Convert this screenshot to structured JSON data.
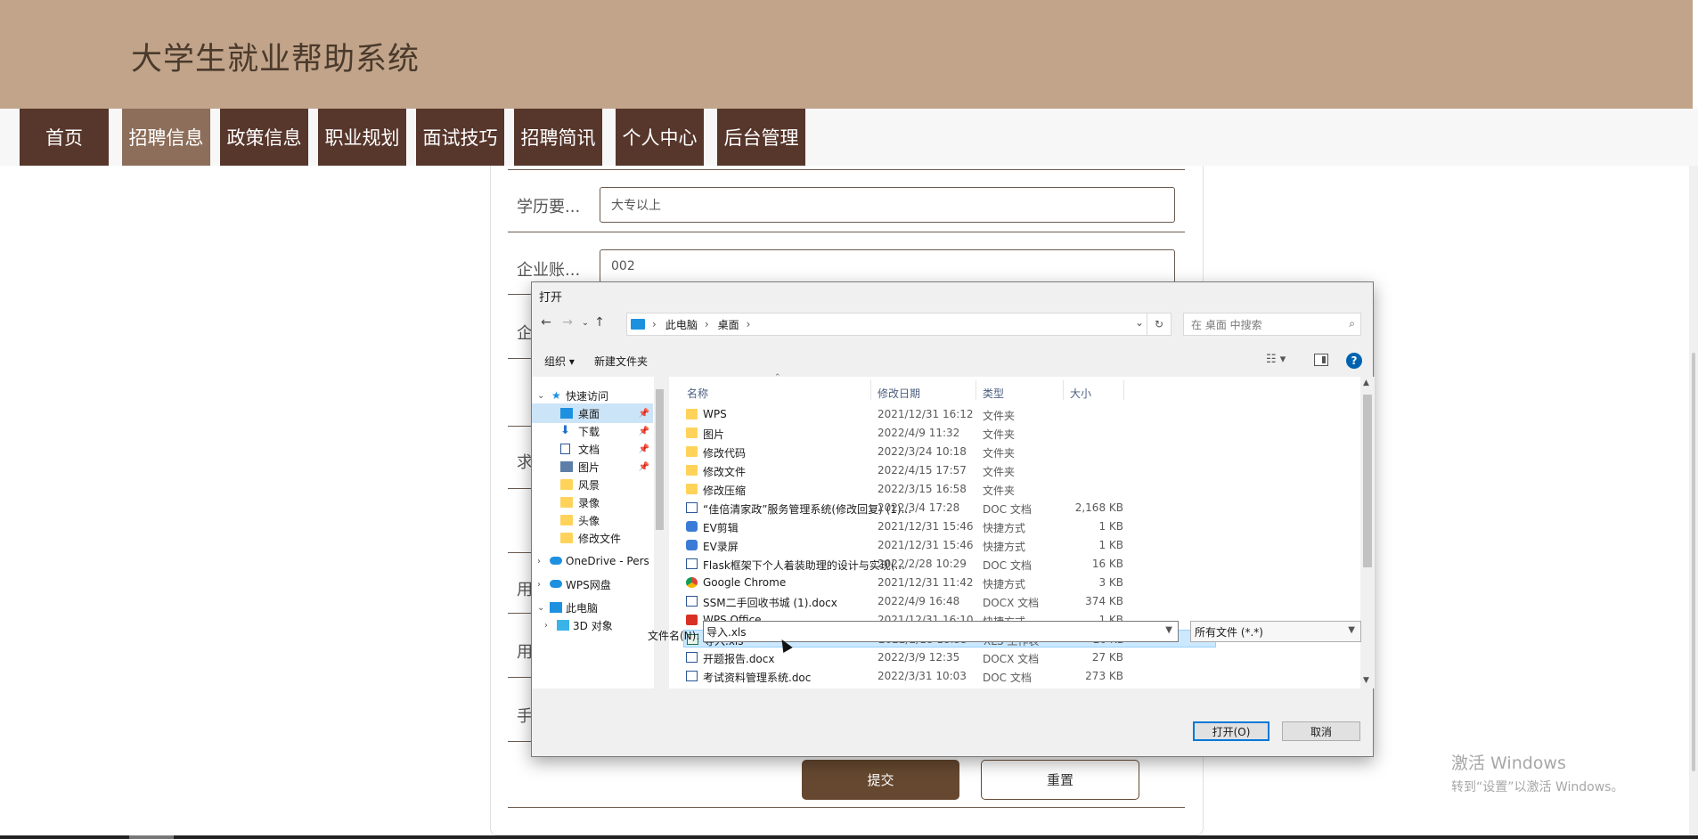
{
  "header": {
    "title": "大学生就业帮助系统"
  },
  "nav": {
    "items": [
      {
        "label": "首页"
      },
      {
        "label": "招聘信息"
      },
      {
        "label": "政策信息"
      },
      {
        "label": "职业规划"
      },
      {
        "label": "面试技巧"
      },
      {
        "label": "招聘简讯"
      },
      {
        "label": "个人中心"
      },
      {
        "label": "后台管理"
      }
    ]
  },
  "form": {
    "education_label": "学历要...",
    "education_value": "大专以上",
    "account_label": "企业账...",
    "account_value": "002",
    "partial_labels": [
      "企",
      "求",
      "用",
      "用",
      "手"
    ],
    "submit_label": "提交",
    "reset_label": "重置"
  },
  "watermark": {
    "line1": "激活 Windows",
    "line2": "转到“设置”以激活 Windows。"
  },
  "dialog": {
    "title": "打开",
    "breadcrumb": [
      "此电脑",
      "桌面"
    ],
    "search_placeholder": "在 桌面 中搜索",
    "toolbar": {
      "organize": "组织",
      "new_folder": "新建文件夹"
    },
    "nav_pane": [
      {
        "label": "快速访问",
        "icon": "star-icon"
      },
      {
        "label": "桌面",
        "icon": "desktop-icon",
        "selected": true
      },
      {
        "label": "下载",
        "icon": "download-icon"
      },
      {
        "label": "文档",
        "icon": "document-icon"
      },
      {
        "label": "图片",
        "icon": "picture-icon"
      },
      {
        "label": "风景",
        "icon": "folder-icon"
      },
      {
        "label": "录像",
        "icon": "folder-icon"
      },
      {
        "label": "头像",
        "icon": "folder-icon"
      },
      {
        "label": "修改文件",
        "icon": "folder-icon"
      },
      {
        "label": "OneDrive - Pers",
        "icon": "onedrive-icon"
      },
      {
        "label": "WPS网盘",
        "icon": "cloud-icon"
      },
      {
        "label": "此电脑",
        "icon": "computer-icon"
      },
      {
        "label": "3D 对象",
        "icon": "3d-objects-icon"
      }
    ],
    "columns": {
      "name": "名称",
      "date": "修改日期",
      "type": "类型",
      "size": "大小"
    },
    "files": [
      {
        "name": "WPS",
        "date": "2021/12/31 16:12",
        "type": "文件夹",
        "size": "",
        "icon": "folder-icon"
      },
      {
        "name": "图片",
        "date": "2022/4/9 11:32",
        "type": "文件夹",
        "size": "",
        "icon": "folder-icon"
      },
      {
        "name": "修改代码",
        "date": "2022/3/24 10:18",
        "type": "文件夹",
        "size": "",
        "icon": "folder-icon"
      },
      {
        "name": "修改文件",
        "date": "2022/4/15 17:57",
        "type": "文件夹",
        "size": "",
        "icon": "folder-icon"
      },
      {
        "name": "修改压缩",
        "date": "2022/3/15 16:58",
        "type": "文件夹",
        "size": "",
        "icon": "folder-icon"
      },
      {
        "name": "“佳倍清家政”服务管理系统(修改回复) (1)...",
        "date": "2022/3/4 17:28",
        "type": "DOC 文档",
        "size": "2,168 KB",
        "icon": "doc-icon"
      },
      {
        "name": "EV剪辑",
        "date": "2021/12/31 15:46",
        "type": "快捷方式",
        "size": "1 KB",
        "icon": "shortcut-icon"
      },
      {
        "name": "EV录屏",
        "date": "2021/12/31 15:46",
        "type": "快捷方式",
        "size": "1 KB",
        "icon": "shortcut-icon"
      },
      {
        "name": "Flask框架下个人着装助理的设计与实现(...",
        "date": "2022/2/28 10:29",
        "type": "DOC 文档",
        "size": "16 KB",
        "icon": "doc-icon"
      },
      {
        "name": "Google Chrome",
        "date": "2021/12/31 11:42",
        "type": "快捷方式",
        "size": "3 KB",
        "icon": "chrome-icon"
      },
      {
        "name": "SSM二手回收书城 (1).docx",
        "date": "2022/4/9 16:48",
        "type": "DOCX 文档",
        "size": "374 KB",
        "icon": "doc-icon"
      },
      {
        "name": "WPS Office",
        "date": "2021/12/31 16:10",
        "type": "快捷方式",
        "size": "1 KB",
        "icon": "wps-icon"
      },
      {
        "name": "导入.xls",
        "date": "2022/2/18 18:33",
        "type": "XLS 工作表",
        "size": "20 KB",
        "icon": "xls-icon",
        "selected": true
      },
      {
        "name": "开题报告.docx",
        "date": "2022/3/9 12:35",
        "type": "DOCX 文档",
        "size": "27 KB",
        "icon": "doc-icon"
      },
      {
        "name": "考试资料管理系统.doc",
        "date": "2022/3/31 10:03",
        "type": "DOC 文档",
        "size": "273 KB",
        "icon": "doc-icon"
      }
    ],
    "filename_label": "文件名(N):",
    "filename_value": "导入.xls",
    "filetype_value": "所有文件 (*.*)",
    "open_label": "打开(O)",
    "cancel_label": "取消"
  }
}
